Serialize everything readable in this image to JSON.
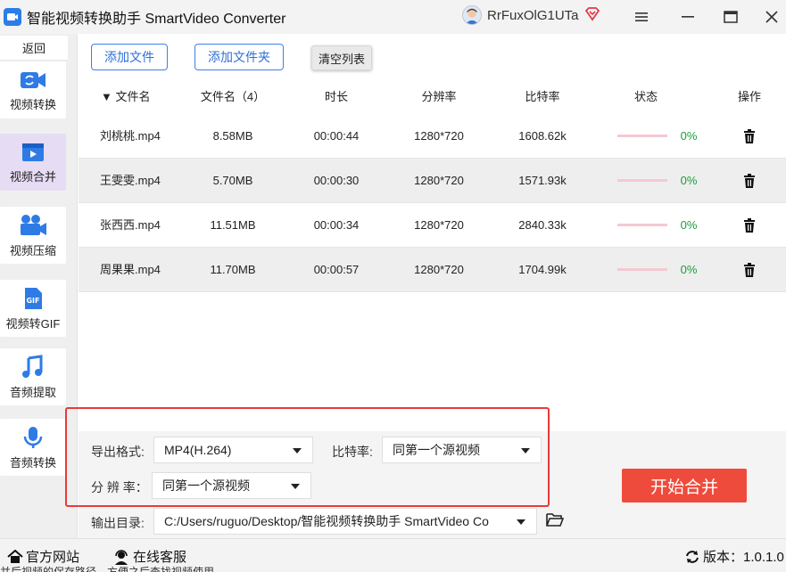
{
  "window": {
    "title": "智能视频转换助手 SmartVideo Converter",
    "username": "RrFuxOlG1UTa"
  },
  "sidebar": {
    "back_label": "返回",
    "items": [
      {
        "label": "视频转换",
        "icon": "video-convert-icon"
      },
      {
        "label": "视频合并",
        "icon": "video-merge-icon",
        "active": true
      },
      {
        "label": "视频压缩",
        "icon": "video-compress-icon"
      },
      {
        "label": "视频转GIF",
        "icon": "gif-icon"
      },
      {
        "label": "音频提取",
        "icon": "music-note-icon"
      },
      {
        "label": "音频转换",
        "icon": "microphone-icon"
      }
    ]
  },
  "toolbar": {
    "add_file": "添加文件",
    "add_folder": "添加文件夹",
    "clear_list": "清空列表"
  },
  "table": {
    "headers": {
      "sort_name": "▼ 文件名",
      "name_count": "文件名（4）",
      "duration": "时长",
      "resolution": "分辨率",
      "bitrate": "比特率",
      "status": "状态",
      "action": "操作"
    },
    "rows": [
      {
        "name": "刘桃桃.mp4",
        "size": "8.58MB",
        "duration": "00:00:44",
        "resolution": "1280*720",
        "bitrate": "1608.62k",
        "progress": "0%"
      },
      {
        "name": "王雯雯.mp4",
        "size": "5.70MB",
        "duration": "00:00:30",
        "resolution": "1280*720",
        "bitrate": "1571.93k",
        "progress": "0%"
      },
      {
        "name": "张西西.mp4",
        "size": "11.51MB",
        "duration": "00:00:34",
        "resolution": "1280*720",
        "bitrate": "2840.33k",
        "progress": "0%"
      },
      {
        "name": "周果果.mp4",
        "size": "11.70MB",
        "duration": "00:00:57",
        "resolution": "1280*720",
        "bitrate": "1704.99k",
        "progress": "0%"
      }
    ]
  },
  "settings": {
    "format_label": "导出格式:",
    "format_value": "MP4(H.264)",
    "bitrate_label": "比特率:",
    "bitrate_value": "同第一个源视频",
    "resolution_label": "分 辨 率：",
    "resolution_value": "同第一个源视频",
    "output_label": "输出目录:",
    "output_value": "C:/Users/ruguo/Desktop/智能视频转换助手 SmartVideo Co",
    "start_button": "开始合并"
  },
  "statusbar": {
    "website": "官方网站",
    "support": "在线客服",
    "version": "版本：1.0.1.0",
    "hint": "并后视频的保存路径，方便之后查找视频使用"
  },
  "colors": {
    "accent_blue": "#3f7ee8",
    "start_red": "#ef4b3c",
    "highlight_red": "#e83a3a",
    "active_nav": "#e6ddf4",
    "progress_green": "#1a9d3a"
  }
}
